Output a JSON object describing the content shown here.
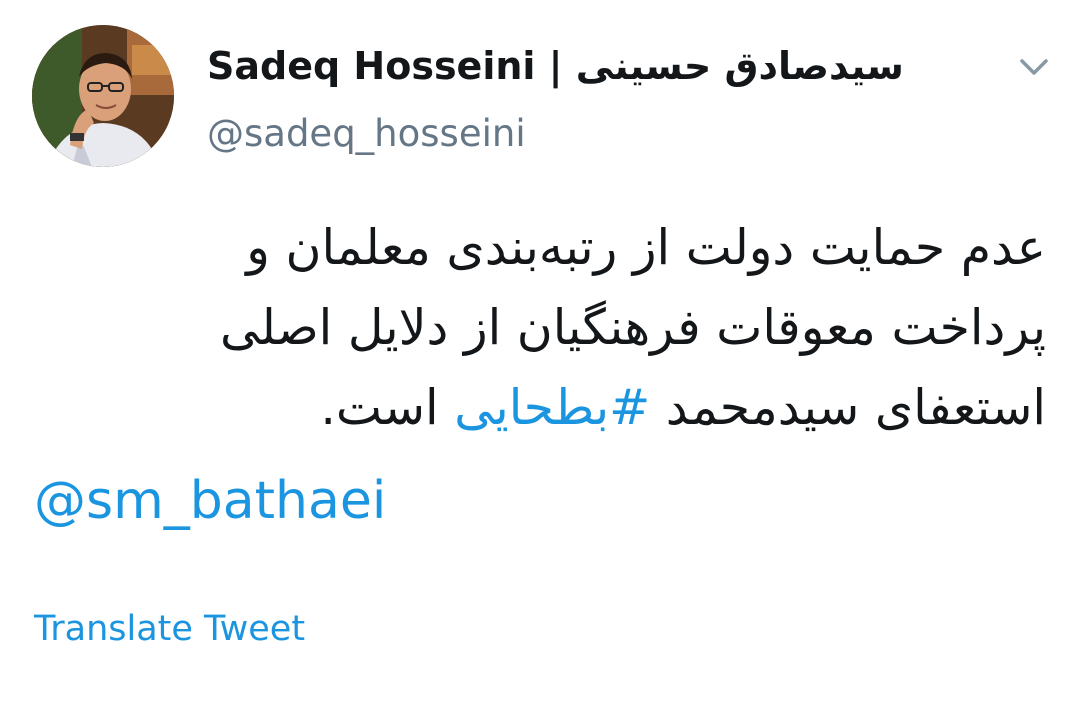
{
  "tweet": {
    "author": {
      "display_name": "Sadeq Hosseini | سیدصادق حسینی",
      "handle": "@sadeq_hosseini",
      "avatar_icon": "profile-photo"
    },
    "menu_icon": "chevron-down-icon",
    "text_lines": [
      "عدم حمایت دولت از رتبه‌بندی معلمان و",
      "پرداخت معوقات فرهنگیان از دلایل اصلی"
    ],
    "last_line_prefix": "استعفای سیدمحمد ",
    "hashtag": "#بطحایی",
    "last_line_suffix": " است.",
    "mention": "@sm_bathaei",
    "translate_label": "Translate Tweet",
    "colors": {
      "link": "#1b95e0",
      "text": "#14171a",
      "secondary": "#657786"
    }
  }
}
